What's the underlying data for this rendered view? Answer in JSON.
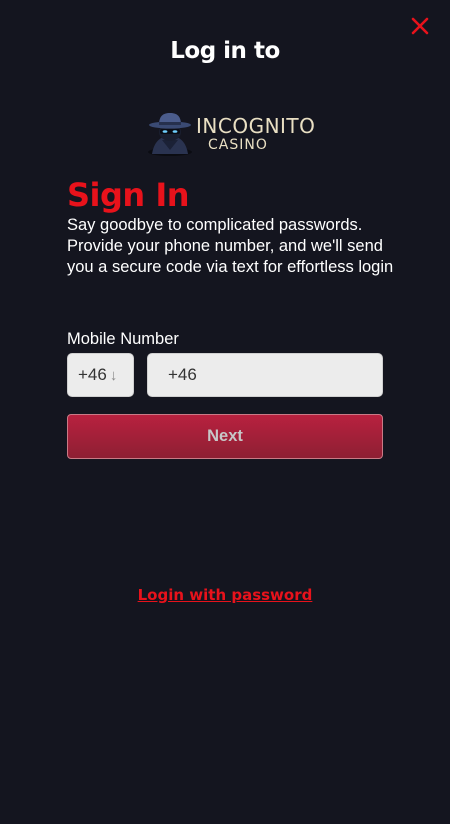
{
  "header": {
    "title": "Log in to"
  },
  "brand": {
    "line1": "INCOGNITO",
    "line2": "CASINO",
    "logo_icon": "spy-detective-icon"
  },
  "signin": {
    "heading": "Sign In",
    "description": "Say goodbye to complicated passwords. Provide your phone number, and we'll send you a secure code via text for effortless login"
  },
  "form": {
    "mobile_label": "Mobile Number",
    "country_code": "+46",
    "country_arrow": "↓",
    "phone_value": "+46",
    "next_label": "Next"
  },
  "links": {
    "password_login": "Login with password"
  },
  "colors": {
    "background": "#14151f",
    "accent_red": "#e8121b",
    "button_gradient_top": "#b8213f",
    "button_gradient_bottom": "#8e1f33",
    "input_bg": "#ececec"
  },
  "icons": {
    "close": "close-icon"
  }
}
